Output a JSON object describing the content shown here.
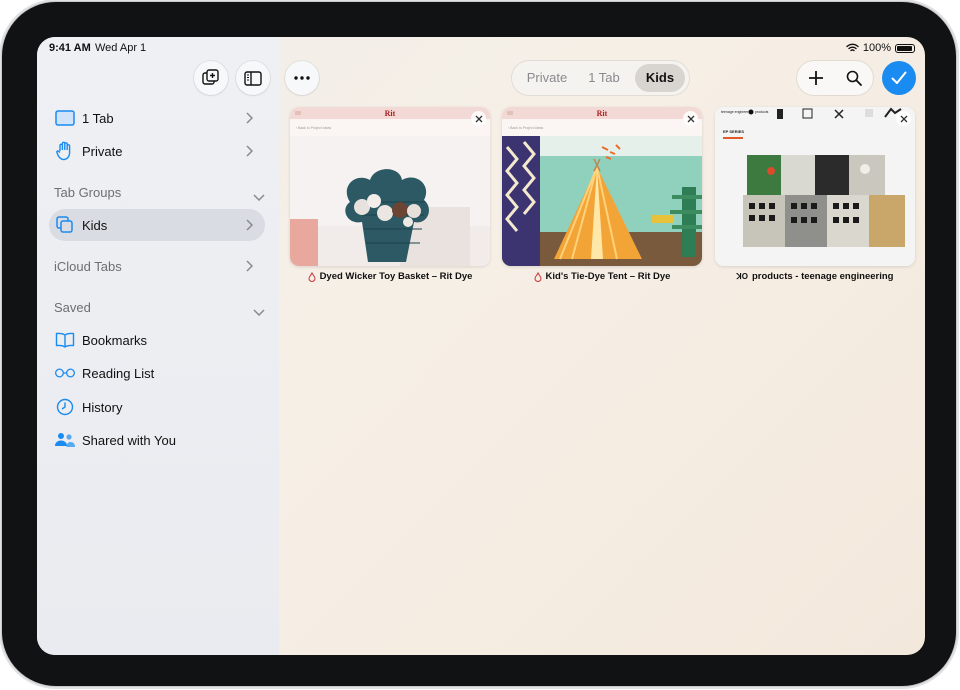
{
  "status_bar": {
    "time": "9:41 AM",
    "date": "Wed Apr 1",
    "battery": "100%"
  },
  "toolbar": {
    "segments": [
      {
        "label": "Private",
        "active": false
      },
      {
        "label": "1 Tab",
        "active": false
      },
      {
        "label": "Kids",
        "active": true
      }
    ],
    "icons": [
      "new-tab-group-icon",
      "sidebar-toggle-icon",
      "more-icon",
      "plus-icon",
      "search-icon",
      "checkmark-icon"
    ],
    "accent": "#1a8bf0"
  },
  "sidebar": {
    "items": [
      {
        "label": "1 Tab",
        "icon": "tablet-icon"
      },
      {
        "label": "Private",
        "icon": "hand-icon"
      }
    ],
    "tab_groups_header": "Tab Groups",
    "tab_groups": [
      {
        "label": "Kids",
        "icon": "tab-group-icon",
        "selected": true
      }
    ],
    "icloud_tabs": "iCloud Tabs",
    "saved_header": "Saved",
    "saved": [
      {
        "label": "Bookmarks",
        "icon": "book-icon"
      },
      {
        "label": "Reading List",
        "icon": "glasses-icon"
      },
      {
        "label": "History",
        "icon": "clock-icon"
      },
      {
        "label": "Shared with You",
        "icon": "shared-people-icon"
      }
    ]
  },
  "tabs": [
    {
      "title": "Dyed Wicker Toy Basket – Rit Dye",
      "site_logo": "Rit",
      "breadcrumb": "‹ Back to Project Ideas",
      "favicon": "drop-icon"
    },
    {
      "title": "Kid's Tie-Dye Tent – Rit Dye",
      "site_logo": "Rit",
      "breadcrumb": "‹ Back to Project Ideas",
      "favicon": "drop-icon"
    },
    {
      "title": "products - teenage engineering",
      "favicon_text": "ꓘO",
      "header_text": "teenage engineering",
      "nav_label": "products",
      "series_label": "EP SERIES"
    }
  ]
}
